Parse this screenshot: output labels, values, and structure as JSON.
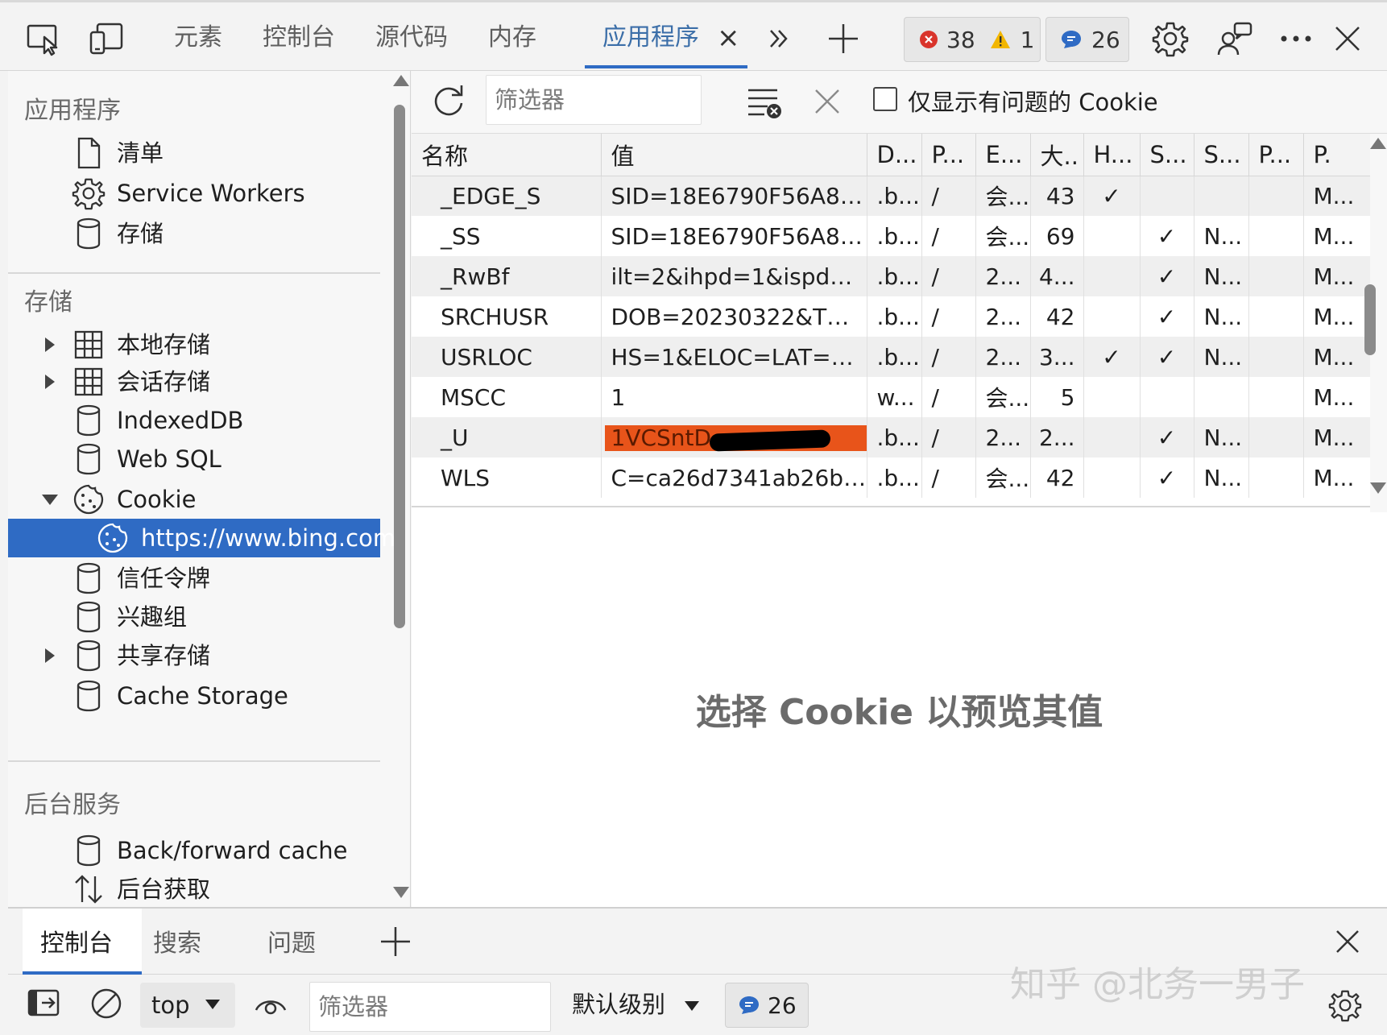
{
  "topbar": {
    "tabs": [
      "元素",
      "控制台",
      "源代码",
      "内存",
      "应用程序"
    ],
    "active_tab_close": "×",
    "error_count": "38",
    "warning_count": "1",
    "message_count": "26"
  },
  "sidebar": {
    "section_app": "应用程序",
    "app_items": [
      "清单",
      "Service Workers",
      "存储"
    ],
    "section_storage": "存储",
    "storage_items": [
      "本地存储",
      "会话存储",
      "IndexedDB",
      "Web SQL",
      "Cookie",
      "https://www.bing.com",
      "信任令牌",
      "兴趣组",
      "共享存储",
      "Cache Storage"
    ],
    "section_background": "后台服务",
    "background_items": [
      "Back/forward cache",
      "后台获取"
    ]
  },
  "cookies": {
    "filter_placeholder": "筛选器",
    "only_issues_label": "仅显示有问题的 Cookie",
    "columns": [
      "名称",
      "值",
      "D...",
      "P...",
      "E...",
      "大..",
      "H...",
      "S...",
      "S...",
      "P...",
      "P."
    ],
    "rows": [
      [
        "_EDGE_S",
        "SID=18E6790F56A86...",
        ".b...",
        "/",
        "会...",
        "43",
        "✓",
        "",
        "",
        "",
        "M..."
      ],
      [
        "_SS",
        "SID=18E6790F56A86...",
        ".b...",
        "/",
        "会...",
        "69",
        "",
        "✓",
        "N...",
        "",
        "M..."
      ],
      [
        "_RwBf",
        "ilt=2&ihpd=1&ispd=...",
        ".b...",
        "/",
        "2...",
        "4...",
        "",
        "✓",
        "N...",
        "",
        "M..."
      ],
      [
        "SRCHUSR",
        "DOB=20230322&T=...",
        ".b...",
        "/",
        "2...",
        "42",
        "",
        "✓",
        "N...",
        "",
        "M..."
      ],
      [
        "USRLOC",
        "HS=1&ELOC=LAT=3...",
        ".b...",
        "/",
        "2...",
        "3...",
        "✓",
        "✓",
        "N...",
        "",
        "M..."
      ],
      [
        "MSCC",
        "1",
        "w...",
        "/",
        "会...",
        "5",
        "",
        "",
        "",
        "",
        "M..."
      ],
      [
        "_U",
        "1VCSntD...",
        ".b...",
        "/",
        "2...",
        "2...",
        "",
        "✓",
        "N...",
        "",
        "M..."
      ],
      [
        "WLS",
        "C=ca26d7341ab26b8...",
        ".b...",
        "/",
        "会...",
        "42",
        "",
        "✓",
        "N...",
        "",
        "M..."
      ]
    ],
    "preview_message": "选择 Cookie 以预览其值"
  },
  "drawer": {
    "tabs": [
      "控制台",
      "搜索",
      "问题"
    ],
    "context": "top",
    "filter_placeholder": "筛选器",
    "level": "默认级别",
    "message_count": "26"
  },
  "watermark": "知乎 @北务一男子"
}
